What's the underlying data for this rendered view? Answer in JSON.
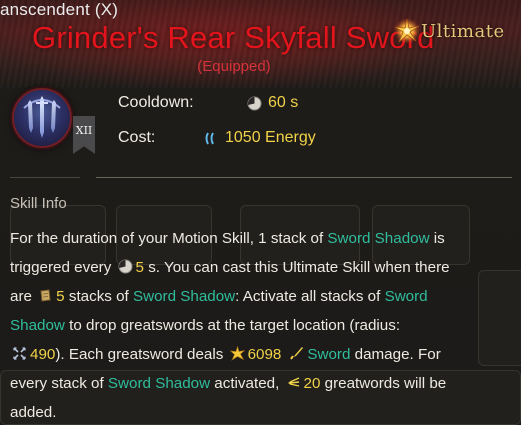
{
  "header": {
    "top_title": "anscendent (X)",
    "skill_name": "Grinder's Rear Skyfall Sword",
    "equipped": "(Equipped)",
    "ultimate_label": "Ultimate"
  },
  "skill": {
    "tier": "XII",
    "icon": "sword-rain-icon"
  },
  "stats": {
    "cooldown_label": "Cooldown:",
    "cooldown_value": "60 s",
    "cooldown_icon": "clock-icon",
    "cost_label": "Cost:",
    "cost_value": "1050 Energy",
    "cost_icon": "energy-icon"
  },
  "skill_info": {
    "title": "Skill Info",
    "line1_a": "For the duration of your Motion Skill, 1 stack of ",
    "sword_shadow": "Sword Shadow",
    "line1_b": " is",
    "line2_a": "triggered every ",
    "interval_value": "5",
    "line2_b": " s. You can cast this Ultimate Skill when there",
    "line3_a": "are ",
    "stacks_value": "5",
    "line3_b": " stacks of ",
    "line3_c": ": Activate all stacks of ",
    "sword_word": "Sword",
    "shadow_word": "Shadow",
    "line4_b": " to drop greatswords at the target location (radius:",
    "radius_value": "490",
    "line5_b": "). Each greatsword deals ",
    "damage_value": "6098",
    "line5_c": " damage. For",
    "line6_a": "every stack of ",
    "line6_b": " activated, ",
    "greatswords_value": "20",
    "line6_c": " greatwords will be",
    "line7": "added."
  },
  "colors": {
    "title_red": "#e3141b",
    "highlight_teal": "#2fbd9c",
    "value_yellow": "#f1d248"
  }
}
